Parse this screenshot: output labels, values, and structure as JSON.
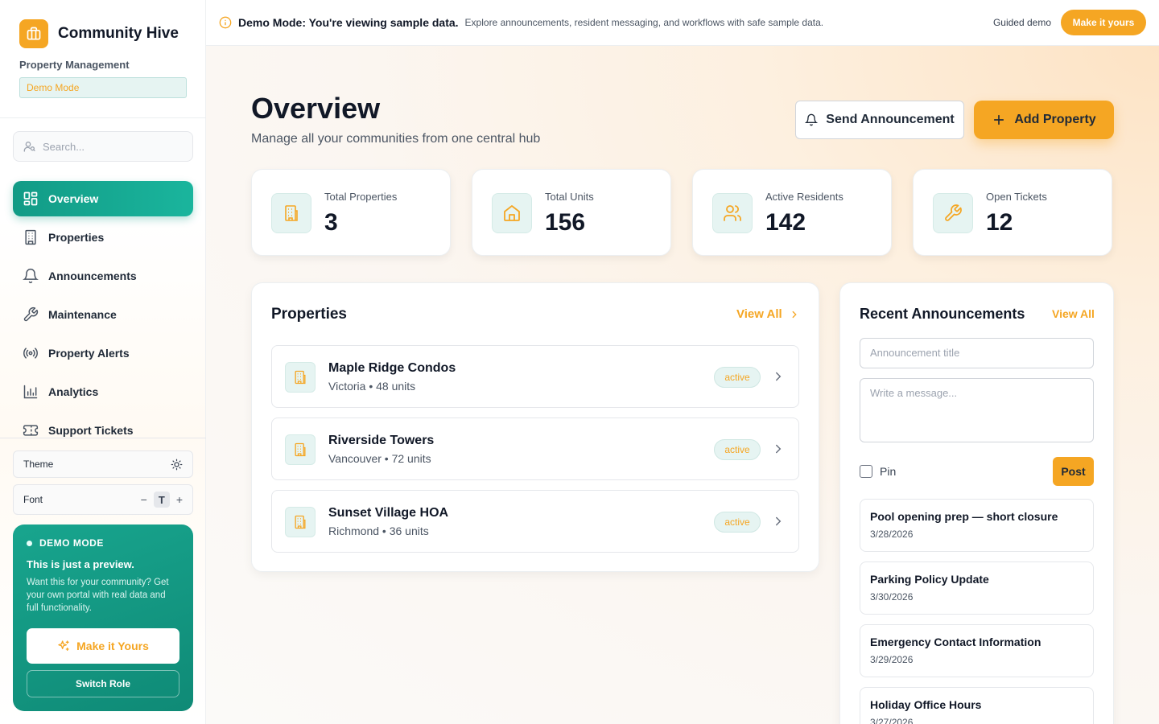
{
  "app": {
    "name": "Community Hive",
    "subtitle": "Property Management",
    "mode_chip": "Demo Mode"
  },
  "colors": {
    "accent": "#f5a623",
    "primary": "#129b86",
    "text": "#111827"
  },
  "sidebar": {
    "search_placeholder": "Search...",
    "items": [
      {
        "label": "Overview",
        "icon": "grid-icon",
        "active": true
      },
      {
        "label": "Properties",
        "icon": "building-icon"
      },
      {
        "label": "Announcements",
        "icon": "bell-icon"
      },
      {
        "label": "Maintenance",
        "icon": "wrench-icon"
      },
      {
        "label": "Property Alerts",
        "icon": "broadcast-icon"
      },
      {
        "label": "Analytics",
        "icon": "bar-chart-icon"
      },
      {
        "label": "Support Tickets",
        "icon": "ticket-icon"
      }
    ],
    "theme_label": "Theme",
    "font_label": "Font",
    "font_minus": "−",
    "font_t": "T",
    "font_plus": "+",
    "demo_card": {
      "tag": "DEMO MODE",
      "title": "This is just a preview.",
      "text": "Want this for your community? Get your own portal with real data and full functionality.",
      "primary_button": "Make it Yours",
      "secondary_button": "Switch Role"
    }
  },
  "topbar": {
    "strong": "Demo Mode: You're viewing sample data.",
    "desc": "Explore announcements, resident messaging, and workflows with safe sample data.",
    "guided": "Guided demo",
    "cta": "Make it yours"
  },
  "main": {
    "title": "Overview",
    "subtitle": "Manage all your communities from one central hub",
    "send_button": "Send Announcement",
    "add_button": "Add Property",
    "stats": [
      {
        "label": "Total Properties",
        "value": "3",
        "icon": "building-icon"
      },
      {
        "label": "Total Units",
        "value": "156",
        "icon": "home-icon"
      },
      {
        "label": "Active Residents",
        "value": "142",
        "icon": "users-icon"
      },
      {
        "label": "Open Tickets",
        "value": "12",
        "icon": "wrench-icon"
      }
    ],
    "properties": {
      "title": "Properties",
      "view_all": "View All",
      "items": [
        {
          "name": "Maple Ridge Condos",
          "meta": "Victoria • 48 units",
          "status": "active"
        },
        {
          "name": "Riverside Towers",
          "meta": "Vancouver • 72 units",
          "status": "active"
        },
        {
          "name": "Sunset Village HOA",
          "meta": "Richmond • 36 units",
          "status": "active"
        }
      ]
    },
    "announcements": {
      "title": "Recent Announcements",
      "view_all": "View All",
      "title_placeholder": "Announcement title",
      "message_placeholder": "Write a message...",
      "pin_label": "Pin",
      "post_button": "Post",
      "items": [
        {
          "title": "Pool opening prep — short closure",
          "date": "3/28/2026"
        },
        {
          "title": "Parking Policy Update",
          "date": "3/30/2026"
        },
        {
          "title": "Emergency Contact Information",
          "date": "3/29/2026"
        },
        {
          "title": "Holiday Office Hours",
          "date": "3/27/2026"
        }
      ]
    }
  }
}
